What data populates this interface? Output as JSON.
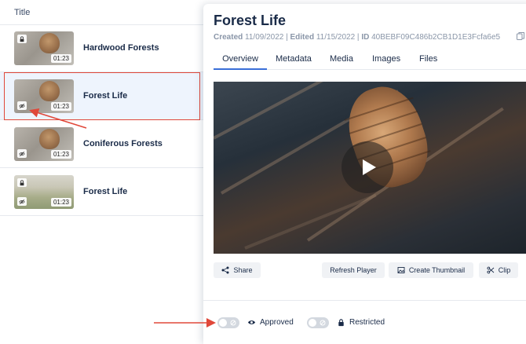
{
  "list": {
    "header": "Title",
    "rows": [
      {
        "title": "Hardwood Forests",
        "duration": "01:23",
        "badge": "lock-icon"
      },
      {
        "title": "Forest Life",
        "duration": "01:23",
        "badge": "eye-off-icon"
      },
      {
        "title": "Coniferous Forests",
        "duration": "01:23",
        "badge": "eye-off-icon"
      },
      {
        "title": "Forest Life",
        "duration": "01:23",
        "badge": "lock-icon"
      }
    ]
  },
  "detail": {
    "title": "Forest Life",
    "created_label": "Created",
    "created_value": "11/09/2022",
    "edited_label": "Edited",
    "edited_value": "11/15/2022",
    "id_label": "ID",
    "id_value": "40BEBF09C486b2CB1D1E3Fcfa6e5",
    "tabs": [
      "Overview",
      "Metadata",
      "Media",
      "Images",
      "Files"
    ],
    "active_tab": "Overview",
    "buttons": {
      "share": "Share",
      "refresh": "Refresh Player",
      "thumbnail": "Create Thumbnail",
      "clip": "Clip"
    },
    "toggles": {
      "approved": "Approved",
      "restricted": "Restricted"
    }
  },
  "colors": {
    "accent": "#3a6fd8",
    "annotation": "#e0483a",
    "selected_row": "#eef4fd"
  }
}
